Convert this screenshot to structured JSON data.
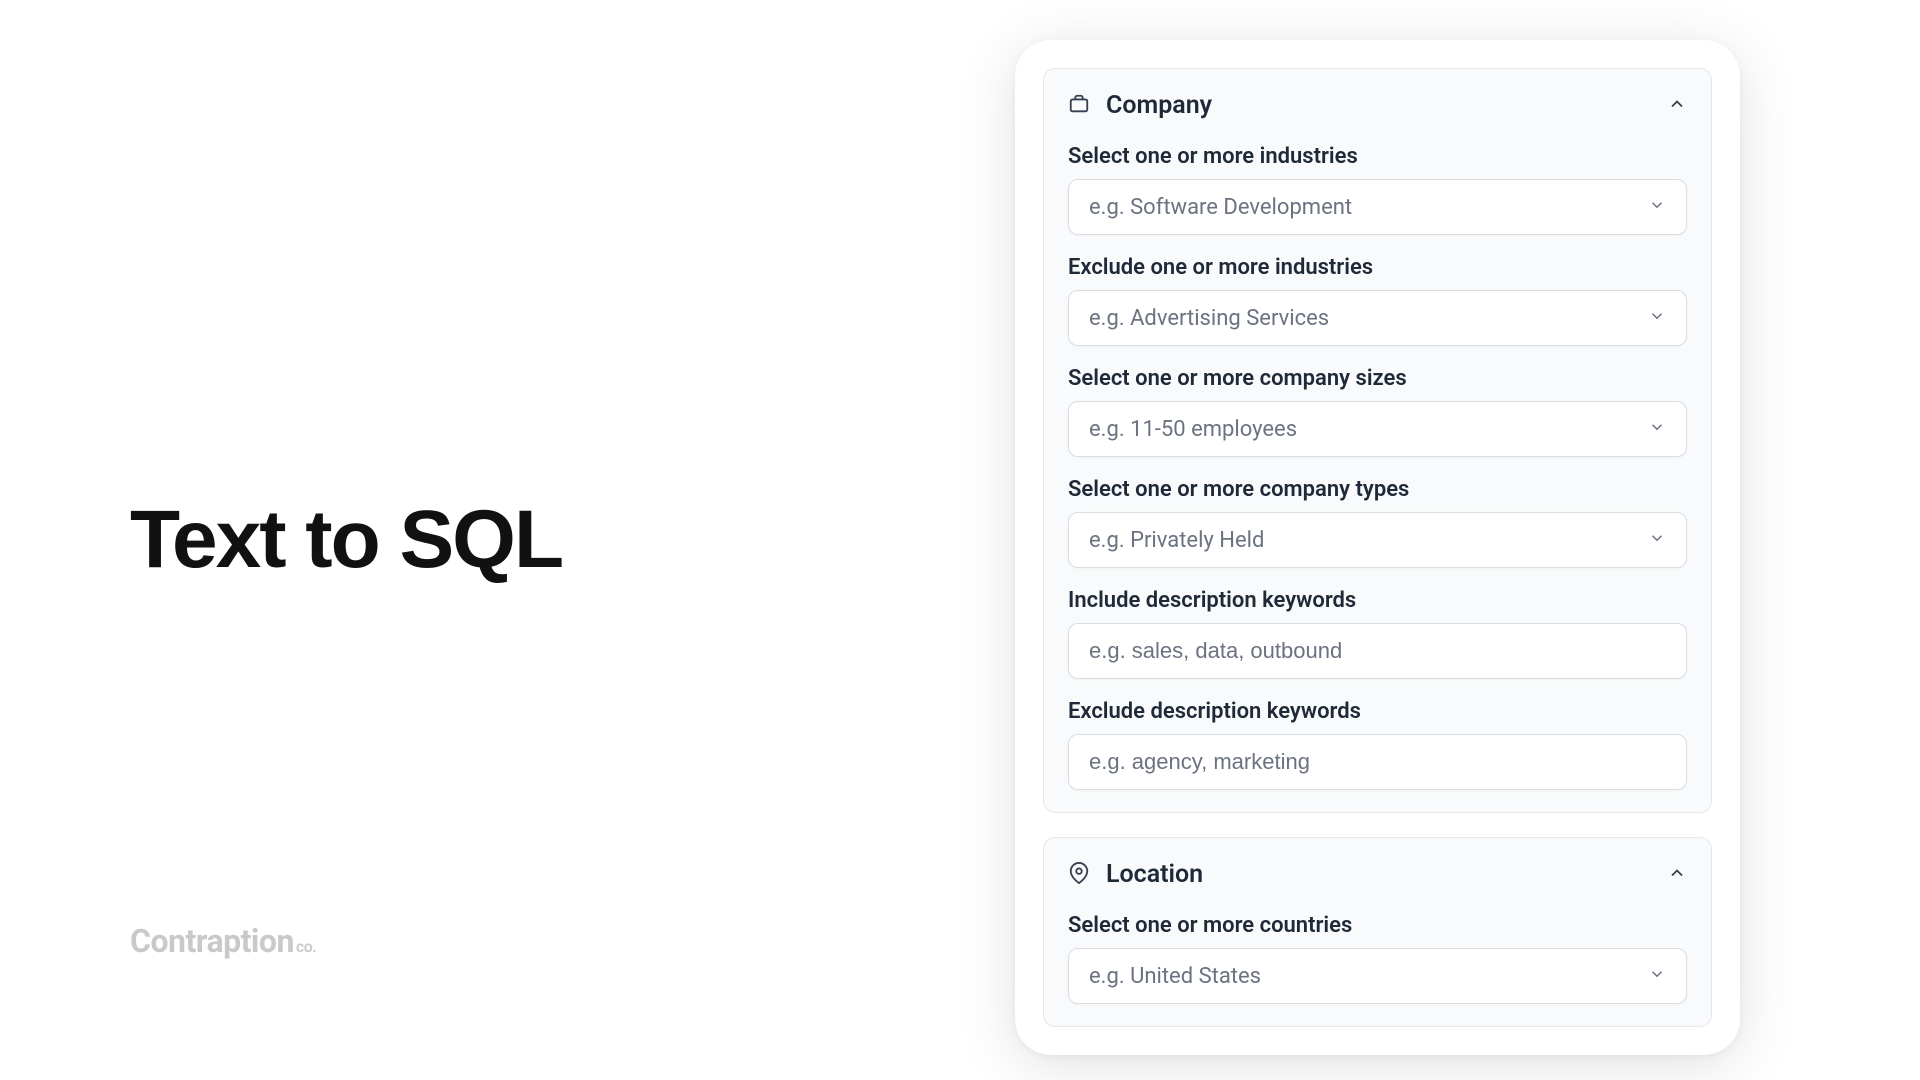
{
  "heading": "Text to SQL",
  "brand": {
    "main": "Contraption",
    "suffix": "co."
  },
  "sections": {
    "company": {
      "title": "Company",
      "fields": {
        "industries": {
          "label": "Select one or more industries",
          "placeholder": "e.g. Software Development"
        },
        "excludeIndustries": {
          "label": "Exclude one or more industries",
          "placeholder": "e.g. Advertising Services"
        },
        "companySizes": {
          "label": "Select one or more company sizes",
          "placeholder": "e.g. 11-50 employees"
        },
        "companyTypes": {
          "label": "Select one or more company types",
          "placeholder": "e.g. Privately Held"
        },
        "includeKeywords": {
          "label": "Include description keywords",
          "placeholder": "e.g. sales, data, outbound"
        },
        "excludeKeywords": {
          "label": "Exclude description keywords",
          "placeholder": "e.g. agency, marketing"
        }
      }
    },
    "location": {
      "title": "Location",
      "fields": {
        "countries": {
          "label": "Select one or more countries",
          "placeholder": "e.g. United States"
        }
      }
    }
  }
}
